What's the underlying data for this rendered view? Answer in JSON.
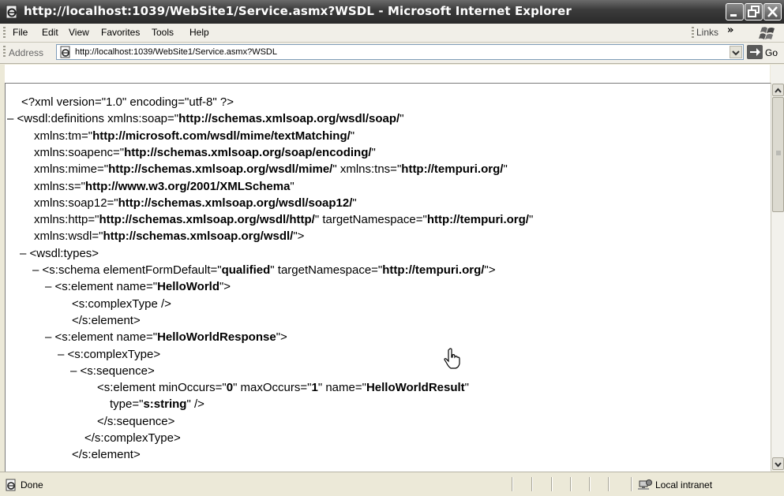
{
  "window": {
    "title": "http://localhost:1039/WebSite1/Service.asmx?WSDL - Microsoft Internet Explorer"
  },
  "menubar": {
    "items": [
      "File",
      "Edit",
      "View",
      "Favorites",
      "Tools",
      "Help"
    ],
    "links_label": "Links",
    "more_chevron": "»"
  },
  "addressbar": {
    "label": "Address",
    "url": "http://localhost:1039/WebSite1/Service.asmx?WSDL",
    "go_label": "Go"
  },
  "document": {
    "lines": [
      {
        "indent": 0,
        "minus": false,
        "segs": [
          {
            "t": "<?xml version=\"1.0\" encoding=\"utf-8\" ?>"
          }
        ]
      },
      {
        "indent": 0,
        "minus": true,
        "segs": [
          {
            "t": "<wsdl:definitions xmlns:soap=\""
          },
          {
            "t": "http://schemas.xmlsoap.org/wsdl/soap/",
            "b": true
          },
          {
            "t": "\""
          }
        ]
      },
      {
        "indent": 1,
        "minus": false,
        "segs": [
          {
            "t": "xmlns:tm=\""
          },
          {
            "t": "http://microsoft.com/wsdl/mime/textMatching/",
            "b": true
          },
          {
            "t": "\""
          }
        ]
      },
      {
        "indent": 1,
        "minus": false,
        "segs": [
          {
            "t": "xmlns:soapenc=\""
          },
          {
            "t": "http://schemas.xmlsoap.org/soap/encoding/",
            "b": true
          },
          {
            "t": "\""
          }
        ]
      },
      {
        "indent": 1,
        "minus": false,
        "segs": [
          {
            "t": "xmlns:mime=\""
          },
          {
            "t": "http://schemas.xmlsoap.org/wsdl/mime/",
            "b": true
          },
          {
            "t": "\" xmlns:tns=\""
          },
          {
            "t": "http://tempuri.org/",
            "b": true
          },
          {
            "t": "\""
          }
        ]
      },
      {
        "indent": 1,
        "minus": false,
        "segs": [
          {
            "t": "xmlns:s=\""
          },
          {
            "t": "http://www.w3.org/2001/XMLSchema",
            "b": true
          },
          {
            "t": "\""
          }
        ]
      },
      {
        "indent": 1,
        "minus": false,
        "segs": [
          {
            "t": "xmlns:soap12=\""
          },
          {
            "t": "http://schemas.xmlsoap.org/wsdl/soap12/",
            "b": true
          },
          {
            "t": "\""
          }
        ]
      },
      {
        "indent": 1,
        "minus": false,
        "segs": [
          {
            "t": "xmlns:http=\""
          },
          {
            "t": "http://schemas.xmlsoap.org/wsdl/http/",
            "b": true
          },
          {
            "t": "\" targetNamespace=\""
          },
          {
            "t": "http://tempuri.org/",
            "b": true
          },
          {
            "t": "\""
          }
        ]
      },
      {
        "indent": 1,
        "minus": false,
        "segs": [
          {
            "t": "xmlns:wsdl=\""
          },
          {
            "t": "http://schemas.xmlsoap.org/wsdl/",
            "b": true
          },
          {
            "t": "\">"
          }
        ]
      },
      {
        "indent": 1,
        "minus": true,
        "segs": [
          {
            "t": "<wsdl:types>"
          }
        ]
      },
      {
        "indent": 2,
        "minus": true,
        "segs": [
          {
            "t": "<s:schema elementFormDefault=\""
          },
          {
            "t": "qualified",
            "b": true
          },
          {
            "t": "\" targetNamespace=\""
          },
          {
            "t": "http://tempuri.org/",
            "b": true
          },
          {
            "t": "\">"
          }
        ]
      },
      {
        "indent": 3,
        "minus": true,
        "segs": [
          {
            "t": "<s:element name=\""
          },
          {
            "t": "HelloWorld",
            "b": true
          },
          {
            "t": "\">"
          }
        ]
      },
      {
        "indent": 4,
        "minus": false,
        "segs": [
          {
            "t": "<s:complexType />"
          }
        ]
      },
      {
        "indent": 4,
        "minus": false,
        "shift": -1,
        "segs": [
          {
            "t": "</s:element>"
          }
        ]
      },
      {
        "indent": 3,
        "minus": true,
        "segs": [
          {
            "t": "<s:element name=\""
          },
          {
            "t": "HelloWorldResponse",
            "b": true
          },
          {
            "t": "\">"
          }
        ]
      },
      {
        "indent": 4,
        "minus": true,
        "segs": [
          {
            "t": "<s:complexType>"
          }
        ]
      },
      {
        "indent": 5,
        "minus": true,
        "segs": [
          {
            "t": "<s:sequence>"
          }
        ]
      },
      {
        "indent": 6,
        "minus": false,
        "segs": [
          {
            "t": "<s:element minOccurs=\""
          },
          {
            "t": "0",
            "b": true
          },
          {
            "t": "\" maxOccurs=\""
          },
          {
            "t": "1",
            "b": true
          },
          {
            "t": "\" name=\""
          },
          {
            "t": "HelloWorldResult",
            "b": true
          },
          {
            "t": "\""
          }
        ]
      },
      {
        "indent": 7,
        "minus": false,
        "segs": [
          {
            "t": "type=\""
          },
          {
            "t": "s:string",
            "b": true
          },
          {
            "t": "\" />"
          }
        ]
      },
      {
        "indent": 6,
        "minus": false,
        "shift": -1,
        "segs": [
          {
            "t": "</s:sequence>"
          }
        ]
      },
      {
        "indent": 5,
        "minus": false,
        "shift": -1,
        "segs": [
          {
            "t": "</s:complexType>"
          }
        ]
      },
      {
        "indent": 4,
        "minus": false,
        "shift": -1,
        "segs": [
          {
            "t": "</s:element>"
          }
        ]
      }
    ]
  },
  "statusbar": {
    "status_text": "Done",
    "zone_text": "Local intranet"
  },
  "icons": {
    "app": "ie-page-icon",
    "page": "ie-page-icon",
    "zone": "local-intranet-icon",
    "cursor": "hand-pointer-icon"
  }
}
